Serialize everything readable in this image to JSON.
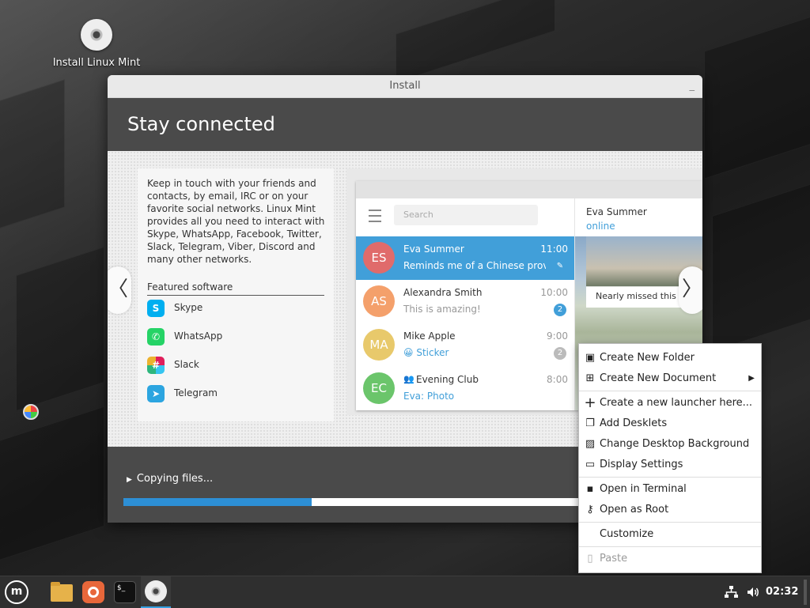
{
  "desktop": {
    "icon_install_label": "Install Linux Mint"
  },
  "window": {
    "title": "Install",
    "minimize": "_",
    "header_title": "Stay connected"
  },
  "slide": {
    "description": "Keep in touch with your friends and contacts, by email, IRC or on your favorite social networks. Linux Mint provides all you need to interact with Skype, WhatsApp, Facebook, Twitter, Slack, Telegram, Viber, Discord and many other networks.",
    "featured_title": "Featured software",
    "featured": [
      {
        "name": "Skype",
        "icon": "skype-icon",
        "color": "#00aff0"
      },
      {
        "name": "WhatsApp",
        "icon": "whatsapp-icon",
        "color": "#25d366"
      },
      {
        "name": "Slack",
        "icon": "slack-icon",
        "color": "#4a154b"
      },
      {
        "name": "Telegram",
        "icon": "telegram-icon",
        "color": "#2ca5e0"
      }
    ],
    "prev_arrow": "〈",
    "next_arrow": "〉"
  },
  "telegram": {
    "search_placeholder": "Search",
    "chats": [
      {
        "initials": "ES",
        "name": "Eva Summer",
        "message": "Reminds me of a Chinese prover...",
        "time": "11:00",
        "badge": "",
        "avatar_color": "#e06b6b",
        "active": true
      },
      {
        "initials": "AS",
        "name": "Alexandra Smith",
        "message": "This is amazing!",
        "time": "10:00",
        "badge": "2",
        "avatar_color": "#f4a06b",
        "active": false
      },
      {
        "initials": "MA",
        "name": "Mike Apple",
        "message": "😀 Sticker",
        "time": "9:00",
        "badge": "2",
        "avatar_color": "#e8c96b",
        "active": false
      },
      {
        "initials": "EC",
        "name": "Evening Club",
        "message": "Eva: Photo",
        "time": "8:00",
        "badge": "",
        "avatar_color": "#6bc56b",
        "active": false
      }
    ],
    "conversation_name": "Eva Summer",
    "conversation_status": "online",
    "photo_caption": "Nearly missed this s"
  },
  "progress": {
    "label": "Copying files...",
    "fraction": 0.33,
    "color": "#2d8fd5"
  },
  "context_menu": {
    "items": [
      {
        "label": "Create New Folder",
        "icon": "folder-add-icon",
        "glyph": "▣",
        "enabled": true
      },
      {
        "label": "Create New Document",
        "icon": "document-add-icon",
        "glyph": "⊞",
        "enabled": true,
        "submenu": "▶"
      },
      {
        "label": "Create a new launcher here...",
        "icon": "plus-icon",
        "glyph": "+",
        "enabled": true
      },
      {
        "label": "Add Desklets",
        "icon": "desklet-icon",
        "glyph": "❐",
        "enabled": true
      },
      {
        "label": "Change Desktop Background",
        "icon": "image-icon",
        "glyph": "▨",
        "enabled": true
      },
      {
        "label": "Display Settings",
        "icon": "display-icon",
        "glyph": "▭",
        "enabled": true
      },
      {
        "label": "Open in Terminal",
        "icon": "terminal-icon",
        "glyph": "▪",
        "enabled": true
      },
      {
        "label": "Open as Root",
        "icon": "key-icon",
        "glyph": "⚷",
        "enabled": true
      },
      {
        "label": "Customize",
        "icon": "",
        "glyph": "",
        "enabled": true
      },
      {
        "label": "Paste",
        "icon": "clipboard-icon",
        "glyph": "📋",
        "enabled": false
      }
    ]
  },
  "taskbar": {
    "clock": "02:32",
    "accent": "#35a0e0"
  }
}
